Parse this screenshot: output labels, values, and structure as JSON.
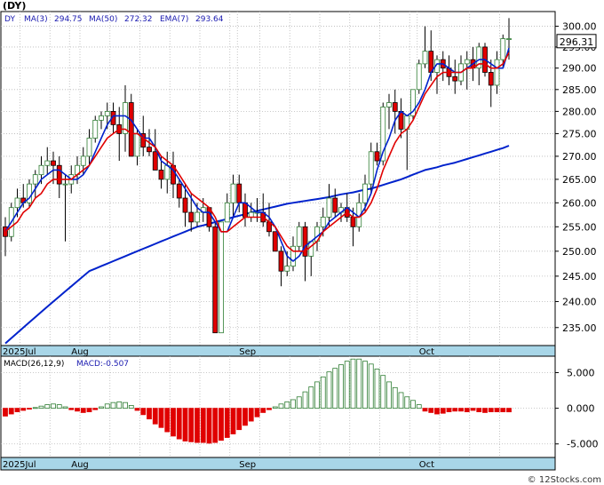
{
  "chart_data": [
    {
      "type": "candlestick",
      "symbol": "(DY)",
      "legend": {
        "ticker": "DY",
        "ma3_label": "MA(3)",
        "ma3_value": "294.75",
        "ma50_label": "MA(50)",
        "ma50_value": "272.32",
        "ema7_label": "EMA(7)",
        "ema7_value": "293.64"
      },
      "last_price": "296.31",
      "y_ticks": [
        "235.00",
        "240.00",
        "245.00",
        "250.00",
        "255.00",
        "260.00",
        "265.00",
        "270.00",
        "275.00",
        "280.00",
        "285.00",
        "290.00",
        "295.00",
        "300.00"
      ],
      "y_tick_values": [
        235,
        240,
        245,
        250,
        255,
        260,
        265,
        270,
        275,
        280,
        285,
        290,
        295,
        300
      ],
      "y_scale": "log",
      "ylim": [
        231.6,
        303.6
      ],
      "month_labels": [
        {
          "label": "2025Jul",
          "index": 0
        },
        {
          "label": "Aug",
          "index": 11
        },
        {
          "label": "Sep",
          "index": 39
        },
        {
          "label": "Oct",
          "index": 69
        }
      ],
      "series": {
        "ohlc": [
          [
            255,
            257,
            249,
            253
          ],
          [
            253,
            260,
            252,
            259
          ],
          [
            259,
            263,
            257,
            261
          ],
          [
            261,
            264,
            259,
            260
          ],
          [
            260,
            265,
            259,
            264
          ],
          [
            264,
            267,
            261,
            266
          ],
          [
            266,
            270,
            264,
            268
          ],
          [
            268,
            272,
            266,
            269
          ],
          [
            269,
            271,
            264,
            268
          ],
          [
            268,
            270,
            261,
            264
          ],
          [
            264,
            266,
            252,
            264
          ],
          [
            264,
            268,
            262,
            266
          ],
          [
            266,
            270,
            264,
            268
          ],
          [
            268,
            272,
            266,
            270
          ],
          [
            270,
            276,
            268,
            274
          ],
          [
            274,
            279,
            273,
            278
          ],
          [
            278,
            280,
            276,
            279
          ],
          [
            279,
            282,
            276,
            280
          ],
          [
            280,
            282,
            275,
            277
          ],
          [
            277,
            281,
            269,
            275
          ],
          [
            275,
            286,
            271,
            282
          ],
          [
            282,
            284,
            270,
            270
          ],
          [
            270,
            276,
            268,
            275
          ],
          [
            275,
            279,
            270,
            272
          ],
          [
            272,
            276,
            270,
            271
          ],
          [
            271,
            276,
            267,
            267
          ],
          [
            267,
            270,
            263,
            265
          ],
          [
            265,
            271,
            262,
            268
          ],
          [
            268,
            271,
            261,
            264
          ],
          [
            264,
            265,
            259,
            261
          ],
          [
            261,
            264,
            255,
            258
          ],
          [
            258,
            262,
            254,
            256
          ],
          [
            256,
            260,
            255,
            258
          ],
          [
            258,
            261,
            256,
            259
          ],
          [
            259,
            259,
            254,
            255
          ],
          [
            255,
            256,
            234,
            234
          ],
          [
            234,
            256,
            234,
            256
          ],
          [
            256,
            262,
            256,
            260
          ],
          [
            260,
            266,
            257,
            264
          ],
          [
            264,
            266,
            258,
            260
          ],
          [
            260,
            262,
            255,
            257
          ],
          [
            257,
            260,
            256,
            258
          ],
          [
            258,
            261,
            256,
            258
          ],
          [
            258,
            262,
            255,
            256
          ],
          [
            256,
            260,
            253,
            254
          ],
          [
            254,
            254,
            250,
            250
          ],
          [
            250,
            251,
            243,
            246
          ],
          [
            246,
            250,
            245,
            247
          ],
          [
            247,
            253,
            246,
            251
          ],
          [
            251,
            256,
            250,
            255
          ],
          [
            255,
            256,
            244,
            249
          ],
          [
            249,
            252,
            245,
            252
          ],
          [
            252,
            256,
            250,
            255
          ],
          [
            255,
            259,
            253,
            257
          ],
          [
            257,
            264,
            255,
            261
          ],
          [
            261,
            263,
            257,
            258
          ],
          [
            258,
            260,
            256,
            259
          ],
          [
            259,
            262,
            256,
            257
          ],
          [
            257,
            259,
            251,
            255
          ],
          [
            255,
            262,
            254,
            260
          ],
          [
            260,
            266,
            258,
            264
          ],
          [
            264,
            273,
            262,
            271
          ],
          [
            271,
            273,
            268,
            269
          ],
          [
            269,
            282,
            268,
            281
          ],
          [
            281,
            284,
            276,
            282
          ],
          [
            282,
            285,
            275,
            280
          ],
          [
            280,
            283,
            274,
            276
          ],
          [
            276,
            279,
            267,
            279
          ],
          [
            279,
            285,
            278,
            285
          ],
          [
            285,
            292,
            284,
            291
          ],
          [
            291,
            300,
            290,
            294
          ],
          [
            294,
            299,
            287,
            289
          ],
          [
            289,
            293,
            284,
            292
          ],
          [
            292,
            294,
            287,
            290
          ],
          [
            290,
            293,
            286,
            288
          ],
          [
            288,
            292,
            284,
            287
          ],
          [
            287,
            293,
            286,
            291
          ],
          [
            291,
            294,
            285,
            292
          ],
          [
            292,
            295,
            287,
            290
          ],
          [
            290,
            296,
            286,
            295
          ],
          [
            295,
            296,
            288,
            289
          ],
          [
            289,
            292,
            281,
            286
          ],
          [
            286,
            294,
            284,
            292
          ],
          [
            292,
            298,
            290,
            297
          ],
          [
            297,
            302,
            292,
            297
          ]
        ],
        "ma3": [
          254,
          256,
          258,
          260,
          261,
          263,
          265,
          266,
          267,
          267,
          266,
          265,
          265,
          266,
          268,
          271,
          274,
          277,
          279,
          279,
          279,
          278,
          276,
          274,
          274,
          272,
          269,
          268,
          267,
          265,
          263,
          261,
          259,
          258,
          258,
          256,
          254,
          254,
          257,
          260,
          260,
          259,
          258,
          258,
          257,
          255,
          252,
          249,
          248,
          249,
          251,
          252,
          253,
          254,
          256,
          257,
          258,
          259,
          258,
          257,
          259,
          262,
          267,
          271,
          274,
          278,
          280,
          279,
          280,
          282,
          285,
          289,
          291,
          291,
          290,
          289,
          289,
          290,
          291,
          292,
          292,
          291,
          290,
          290,
          294.75
        ],
        "ema7": [
          254,
          255,
          256,
          258,
          259,
          261,
          262,
          264,
          265,
          265,
          265,
          265,
          266,
          267,
          268,
          270,
          272,
          274,
          275,
          276,
          276,
          275,
          275,
          274,
          273,
          272,
          270,
          269,
          268,
          266,
          264,
          262,
          261,
          260,
          259,
          257,
          254,
          254,
          255,
          256,
          257,
          257,
          257,
          257,
          256,
          255,
          253,
          251,
          250,
          250,
          250,
          251,
          252,
          254,
          255,
          256,
          257,
          258,
          257,
          257,
          258,
          260,
          263,
          267,
          270,
          273,
          275,
          276,
          278,
          281,
          284,
          286,
          288,
          289,
          289,
          289,
          289,
          290,
          290,
          291,
          291,
          290,
          290,
          291,
          293.64
        ],
        "ma50": [
          232,
          233,
          234,
          235,
          236,
          237,
          238,
          239,
          240,
          241,
          242,
          243,
          244,
          245,
          246,
          246.5,
          247,
          247.5,
          248,
          248.5,
          249,
          249.5,
          250,
          250.5,
          251,
          251.5,
          252,
          252.5,
          253,
          253.5,
          254,
          254.5,
          255,
          255.3,
          255.6,
          256,
          256.3,
          256.6,
          257,
          257.3,
          257.6,
          258,
          258.3,
          258.6,
          258.9,
          259.2,
          259.5,
          259.8,
          260,
          260.2,
          260.4,
          260.6,
          260.8,
          261,
          261.2,
          261.5,
          261.8,
          262,
          262.2,
          262.5,
          262.8,
          263,
          263.4,
          263.8,
          264.2,
          264.6,
          265,
          265.5,
          266,
          266.5,
          267,
          267.3,
          267.6,
          268,
          268.3,
          268.6,
          269,
          269.4,
          269.8,
          270.2,
          270.6,
          271,
          271.4,
          271.8,
          272.32
        ]
      }
    },
    {
      "type": "bar",
      "title": "MACD(26,12,9)",
      "value_label": "MACD:-0.507",
      "y_ticks": [
        "5.000",
        "0.000",
        "-5.000"
      ],
      "y_tick_values": [
        5,
        0,
        -5
      ],
      "ylim": [
        -6.9,
        7.3
      ],
      "month_labels": [
        {
          "label": "2025Jul",
          "index": 0
        },
        {
          "label": "Aug",
          "index": 11
        },
        {
          "label": "Sep",
          "index": 39
        },
        {
          "label": "Oct",
          "index": 69
        }
      ],
      "values": [
        -1.1,
        -0.8,
        -0.5,
        -0.3,
        -0.1,
        0.1,
        0.3,
        0.5,
        0.6,
        0.5,
        0.2,
        -0.2,
        -0.4,
        -0.6,
        -0.5,
        -0.2,
        0.2,
        0.6,
        0.8,
        0.9,
        0.8,
        0.4,
        -0.3,
        -0.9,
        -1.5,
        -2.2,
        -2.7,
        -3.3,
        -3.9,
        -4.3,
        -4.6,
        -4.7,
        -4.8,
        -4.8,
        -4.9,
        -4.8,
        -4.5,
        -4.1,
        -3.6,
        -3.0,
        -2.4,
        -1.8,
        -1.2,
        -0.6,
        -0.2,
        0.2,
        0.6,
        0.9,
        1.2,
        1.6,
        2.3,
        3.0,
        3.7,
        4.4,
        5.1,
        5.6,
        6.1,
        6.6,
        6.9,
        6.9,
        6.6,
        6.2,
        5.5,
        4.6,
        3.7,
        2.9,
        2.2,
        1.6,
        1.1,
        0.5,
        -0.4,
        -0.6,
        -0.8,
        -0.7,
        -0.5,
        -0.4,
        -0.4,
        -0.5,
        -0.3,
        -0.5,
        -0.6,
        -0.5,
        -0.5,
        -0.5,
        -0.507
      ]
    }
  ],
  "watermark": "© 12Stocks.com",
  "colors": {
    "up": "#2e7d32",
    "down": "#e00000",
    "ma50": "#0022cc",
    "ma3": "#0022cc",
    "ema7": "#e00000",
    "axis_band": "#a8d6e8",
    "grid": "#b8b8b8",
    "legend_text": "#1a1ab0"
  }
}
